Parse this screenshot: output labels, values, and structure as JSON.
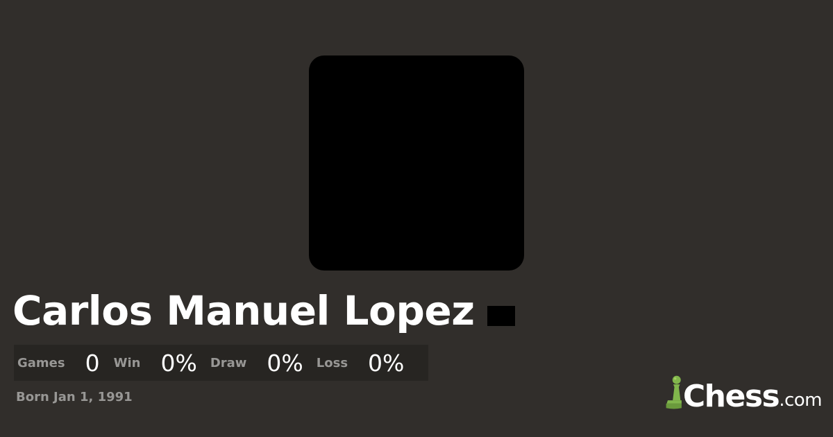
{
  "player": {
    "name": "Carlos Manuel Lopez",
    "born": "Born Jan 1, 1991"
  },
  "stats": {
    "games_label": "Games",
    "games_value": "0",
    "win_label": "Win",
    "win_value": "0%",
    "draw_label": "Draw",
    "draw_value": "0%",
    "loss_label": "Loss",
    "loss_value": "0%"
  },
  "brand": {
    "name": "Chess",
    "suffix": ".com",
    "icon": "pawn-icon",
    "accent_color": "#81b64c"
  },
  "colors": {
    "background": "#312e2b",
    "stats_background": "#272522",
    "label": "#989795",
    "text": "#ffffff"
  }
}
